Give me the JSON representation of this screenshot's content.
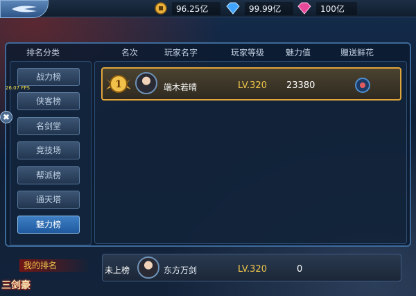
{
  "topbar": {
    "currencies": [
      {
        "icon": "gold-coin-icon",
        "value": "96.25亿"
      },
      {
        "icon": "blue-diamond-icon",
        "value": "99.99亿"
      },
      {
        "icon": "pink-gem-icon",
        "value": "100亿"
      }
    ]
  },
  "headers": {
    "category": "排名分类",
    "rank": "名次",
    "player_name": "玩家名字",
    "player_level": "玩家等级",
    "charm": "魅力值",
    "gift": "赠送鲜花"
  },
  "sidebar": {
    "items": [
      {
        "label": "战力榜"
      },
      {
        "label": "侠客榜"
      },
      {
        "label": "名剑堂"
      },
      {
        "label": "竞技场"
      },
      {
        "label": "帮派榜"
      },
      {
        "label": "通天塔"
      },
      {
        "label": "魅力榜",
        "active": true
      }
    ]
  },
  "ranking": {
    "rows": [
      {
        "rank": "1",
        "name": "端木若晴",
        "level": "LV.320",
        "charm": "23380",
        "gift_icon": "flower-gift-icon"
      }
    ]
  },
  "my_rank": {
    "title": "我的排名",
    "rank_text": "未上榜",
    "name": "东方万剑",
    "level": "LV.320",
    "charm": "0"
  },
  "overlay": {
    "fps": "26.07 FPS",
    "close_symbol": "✖",
    "logo_text": "三剑豪"
  },
  "colors": {
    "accent_gold": "#e2a63a",
    "level_text": "#f1c64b",
    "active_tab": "#3f7fc4"
  }
}
